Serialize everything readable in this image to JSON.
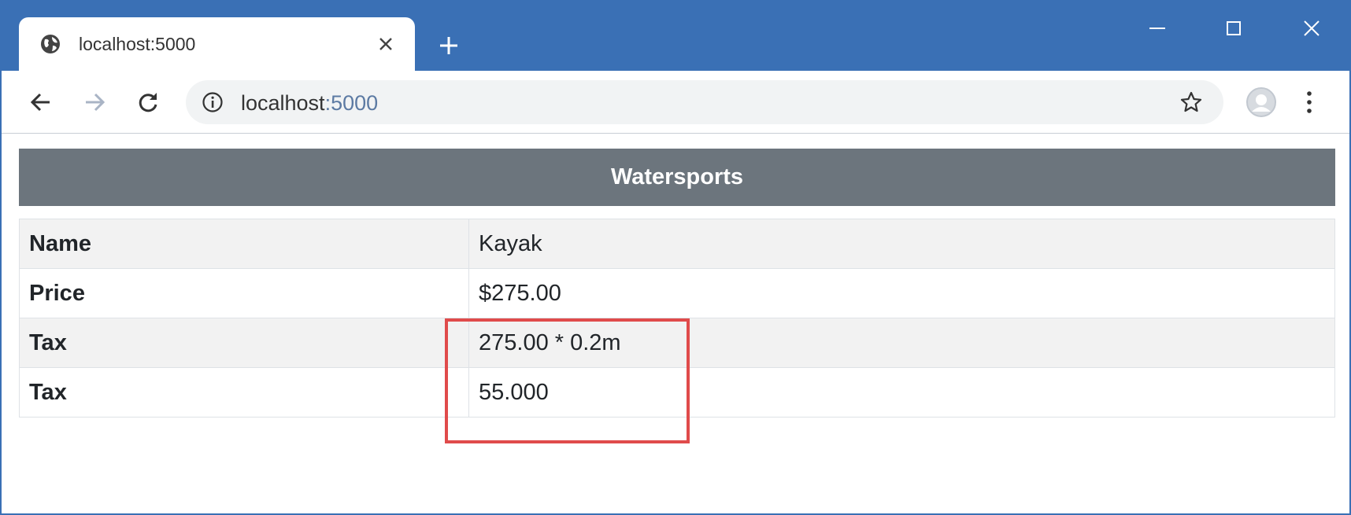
{
  "browser": {
    "tab": {
      "title": "localhost:5000"
    },
    "address": {
      "host": "localhost",
      "port": ":5000"
    }
  },
  "page": {
    "category": "Watersports",
    "rows": [
      {
        "label": "Name",
        "value": "Kayak"
      },
      {
        "label": "Price",
        "value": "$275.00"
      },
      {
        "label": "Tax",
        "value": "275.00 * 0.2m"
      },
      {
        "label": "Tax",
        "value": "55.000"
      }
    ]
  },
  "colors": {
    "chrome_blue": "#3a70b5",
    "header_gray": "#6c757d",
    "highlight_red": "#e04b4b"
  }
}
